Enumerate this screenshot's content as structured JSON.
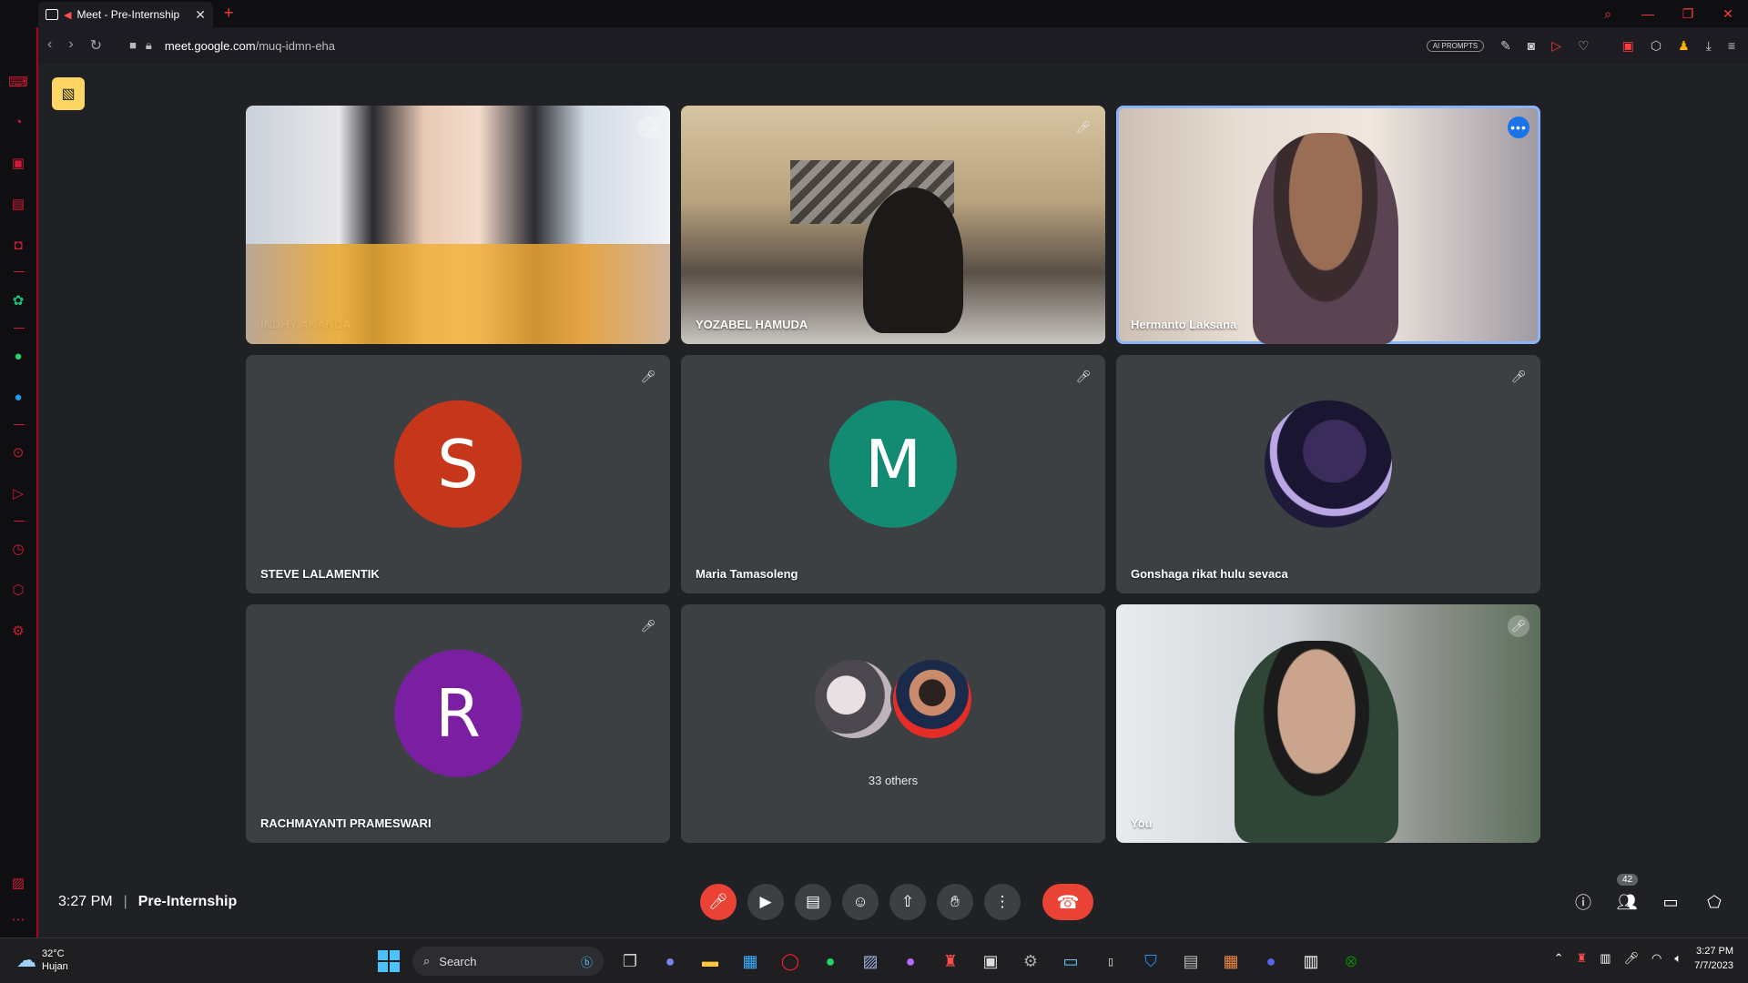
{
  "browser": {
    "tab_title": "Meet - Pre-Internship",
    "url_domain": "meet.google.com",
    "url_path": "/muq-idmn-eha",
    "ai_prompts": "AI PROMPTS"
  },
  "participants": [
    {
      "name": "INDHY ANANDA",
      "type": "video"
    },
    {
      "name": "YOZABEL HAMUDA",
      "type": "video"
    },
    {
      "name": "Hermanto Laksana",
      "type": "video",
      "active": true
    },
    {
      "name": "STEVE LALAMENTIK",
      "type": "avatar",
      "initial": "S",
      "color": "#c5361a"
    },
    {
      "name": "Maria Tamasoleng",
      "type": "avatar",
      "initial": "M",
      "color": "#138a72"
    },
    {
      "name": "Gonshaga rikat hulu sevaca",
      "type": "avatar-image"
    },
    {
      "name": "RACHMAYANTI PRAMESWARI",
      "type": "avatar",
      "initial": "R",
      "color": "#7b1fa2"
    },
    {
      "name": "",
      "type": "others",
      "count_label": "33 others"
    },
    {
      "name": "You",
      "type": "video"
    }
  ],
  "bottom_bar": {
    "time": "3:27 PM",
    "separator": "|",
    "meeting_title": "Pre-Internship",
    "people_count": "42"
  },
  "taskbar": {
    "temperature": "32°C",
    "weather": "Hujan",
    "search_label": "Search",
    "clock_time": "3:27 PM",
    "clock_date": "7/7/2023"
  },
  "colors": {
    "meet_bg": "#202124",
    "tile_bg": "#3c4043",
    "end_call": "#ea4335",
    "active_outline": "#8ab4f8",
    "opera_red": "#d01b35"
  }
}
